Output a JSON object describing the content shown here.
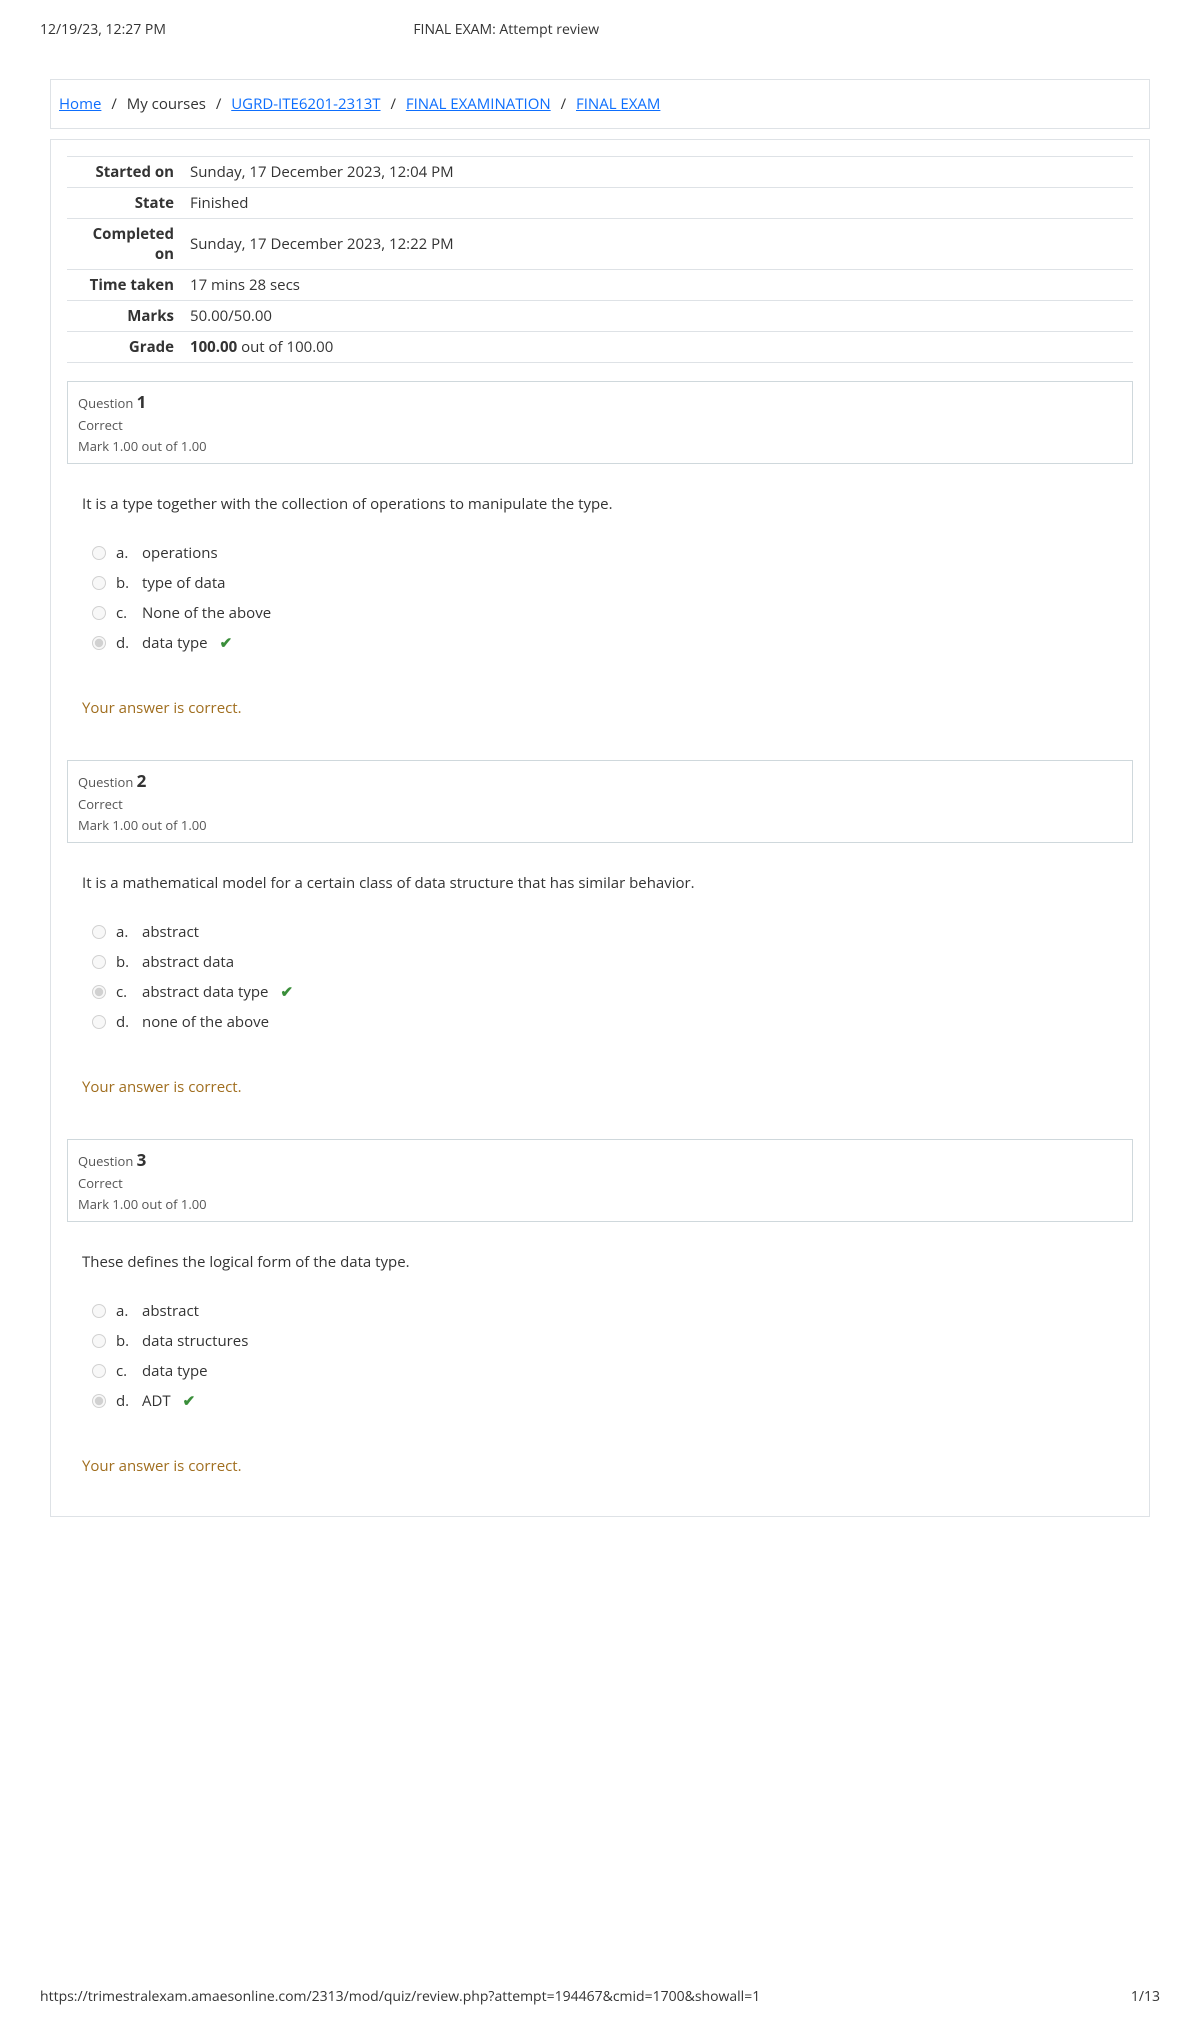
{
  "header": {
    "timestamp": "12/19/23, 12:27 PM",
    "title": "FINAL EXAM: Attempt review"
  },
  "breadcrumb": {
    "home": "Home",
    "mycourses": "My courses",
    "course": "UGRD-ITE6201-2313T",
    "section": "FINAL EXAMINATION",
    "item": "FINAL EXAM"
  },
  "summary": {
    "started_on_label": "Started on",
    "started_on": "Sunday, 17 December 2023, 12:04 PM",
    "state_label": "State",
    "state": "Finished",
    "completed_on_label": "Completed on",
    "completed_on": "Sunday, 17 December 2023, 12:22 PM",
    "time_taken_label": "Time taken",
    "time_taken": "17 mins 28 secs",
    "marks_label": "Marks",
    "marks": "50.00/50.00",
    "grade_label": "Grade",
    "grade_bold": "100.00",
    "grade_rest": " out of 100.00"
  },
  "labels": {
    "question": "Question",
    "correct": "Correct",
    "mark": "Mark 1.00 out of 1.00",
    "feedback": "Your answer is correct."
  },
  "questions": [
    {
      "num": "1",
      "text": "It is a type together with the collection of operations to manipulate the type.",
      "options": [
        {
          "letter": "a.",
          "text": "operations",
          "selected": false,
          "correct": false
        },
        {
          "letter": "b.",
          "text": "type of data",
          "selected": false,
          "correct": false
        },
        {
          "letter": "c.",
          "text": "None of the above",
          "selected": false,
          "correct": false
        },
        {
          "letter": "d.",
          "text": "data type",
          "selected": true,
          "correct": true
        }
      ]
    },
    {
      "num": "2",
      "text": "It is a mathematical model for a certain class of data structure that has similar behavior.",
      "options": [
        {
          "letter": "a.",
          "text": "abstract",
          "selected": false,
          "correct": false
        },
        {
          "letter": "b.",
          "text": "abstract data",
          "selected": false,
          "correct": false
        },
        {
          "letter": "c.",
          "text": "abstract data type",
          "selected": true,
          "correct": true
        },
        {
          "letter": "d.",
          "text": "none of the above",
          "selected": false,
          "correct": false
        }
      ]
    },
    {
      "num": "3",
      "text": "These defines the logical form of the data type.",
      "options": [
        {
          "letter": "a.",
          "text": "abstract",
          "selected": false,
          "correct": false
        },
        {
          "letter": "b.",
          "text": "data structures",
          "selected": false,
          "correct": false
        },
        {
          "letter": "c.",
          "text": "data type",
          "selected": false,
          "correct": false
        },
        {
          "letter": "d.",
          "text": "ADT",
          "selected": true,
          "correct": true
        }
      ]
    }
  ],
  "footer": {
    "url": "https://trimestralexam.amaesonline.com/2313/mod/quiz/review.php?attempt=194467&cmid=1700&showall=1",
    "pagenum": "1/13"
  }
}
